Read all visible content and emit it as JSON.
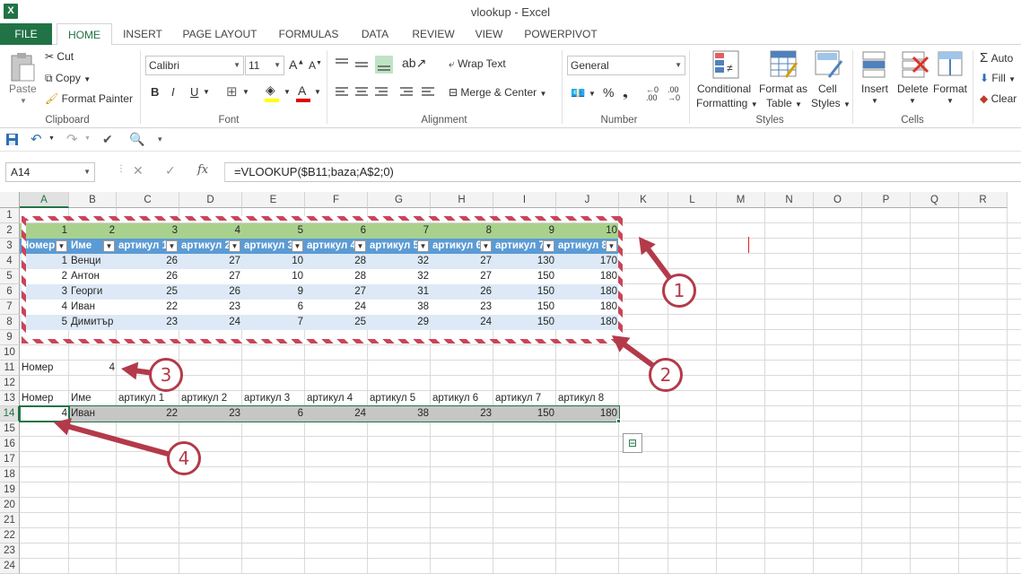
{
  "window": {
    "title": "vlookup - Excel"
  },
  "tabs": [
    "FILE",
    "HOME",
    "INSERT",
    "PAGE LAYOUT",
    "FORMULAS",
    "DATA",
    "REVIEW",
    "VIEW",
    "POWERPIVOT"
  ],
  "ribbon": {
    "clipboard": {
      "paste": "Paste",
      "cut": "Cut",
      "copy": "Copy",
      "format_painter": "Format Painter",
      "label": "Clipboard"
    },
    "font": {
      "name": "Calibri",
      "size": "11",
      "bold": "B",
      "italic": "I",
      "underline": "U",
      "label": "Font"
    },
    "alignment": {
      "wrap": "Wrap Text",
      "merge": "Merge & Center",
      "label": "Alignment"
    },
    "number": {
      "format": "General",
      "label": "Number"
    },
    "styles": {
      "conditional": "Conditional",
      "conditional2": "Formatting",
      "format_as": "Format as",
      "format_as2": "Table",
      "cell": "Cell",
      "cell2": "Styles",
      "label": "Styles"
    },
    "cells": {
      "insert": "Insert",
      "delete": "Delete",
      "format": "Format",
      "label": "Cells"
    },
    "editing": {
      "autosum": "Auto",
      "fill": "Fill",
      "clear": "Clear"
    }
  },
  "formula_bar": {
    "name_box": "A14",
    "fx": "fx",
    "formula": "=VLOOKUP($B11;baza;A$2;0)"
  },
  "columns": [
    "A",
    "B",
    "C",
    "D",
    "E",
    "F",
    "G",
    "H",
    "I",
    "J",
    "K",
    "L",
    "M",
    "N",
    "O",
    "P",
    "Q",
    "R"
  ],
  "rows": [
    "1",
    "2",
    "3",
    "4",
    "5",
    "6",
    "7",
    "8",
    "9",
    "10",
    "11",
    "12",
    "13",
    "14",
    "15",
    "16",
    "17",
    "18",
    "19",
    "20",
    "21",
    "22",
    "23",
    "24"
  ],
  "sheet": {
    "row2": [
      "1",
      "2",
      "3",
      "4",
      "5",
      "6",
      "7",
      "8",
      "9",
      "10"
    ],
    "table_headers": [
      "Номер",
      "Име",
      "артикул 1",
      "артикул 2",
      "артикул 3",
      "артикул 4",
      "артикул 5",
      "артикул 6",
      "артикул 7",
      "артикул 8"
    ],
    "table_rows": [
      [
        "1",
        "Венци",
        "26",
        "27",
        "10",
        "28",
        "32",
        "27",
        "130",
        "170"
      ],
      [
        "2",
        "Антон",
        "26",
        "27",
        "10",
        "28",
        "32",
        "27",
        "150",
        "180"
      ],
      [
        "3",
        "Георги",
        "25",
        "26",
        "9",
        "27",
        "31",
        "26",
        "150",
        "180"
      ],
      [
        "4",
        "Иван",
        "22",
        "23",
        "6",
        "24",
        "38",
        "23",
        "150",
        "180"
      ],
      [
        "5",
        "Димитър",
        "23",
        "24",
        "7",
        "25",
        "29",
        "24",
        "150",
        "180"
      ]
    ],
    "lookup_label": "Номер",
    "lookup_value": "4",
    "result_headers": [
      "Номер",
      "Име",
      "артикул 1",
      "артикул 2",
      "артикул 3",
      "артикул 4",
      "артикул 5",
      "артикул 6",
      "артикул 7",
      "артикул 8"
    ],
    "result_row": [
      "4",
      "Иван",
      "22",
      "23",
      "6",
      "24",
      "38",
      "23",
      "150",
      "180"
    ]
  },
  "callouts": [
    "1",
    "2",
    "3",
    "4"
  ],
  "colors": {
    "accent": "#217346",
    "callout": "#b33a4a",
    "table_header": "#5b9bd5",
    "band": "#dde9f6",
    "row2": "#a9d18e"
  }
}
